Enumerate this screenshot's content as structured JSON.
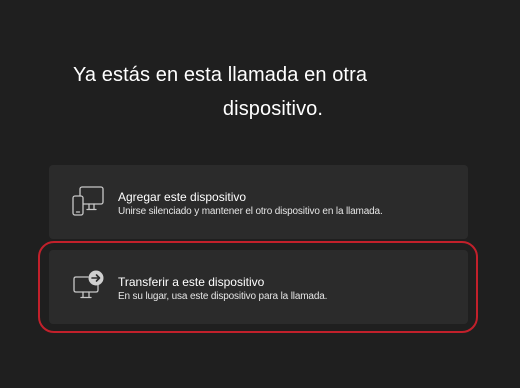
{
  "dialog": {
    "title_line1": "Ya estás en esta llamada en otra",
    "title_line2": "dispositivo."
  },
  "options": [
    {
      "label": "Agregar este dispositivo",
      "description": "Unirse silenciado y mantener el otro dispositivo en la llamada.",
      "icon": "add-device-icon"
    },
    {
      "label": "Transferir a este dispositivo",
      "description": "En su lugar, usa este dispositivo para la llamada.",
      "icon": "transfer-device-icon"
    }
  ],
  "colors": {
    "background": "#1f1f1f",
    "card": "#2b2b2b",
    "highlight": "#c2202b",
    "text": "#ffffff"
  }
}
